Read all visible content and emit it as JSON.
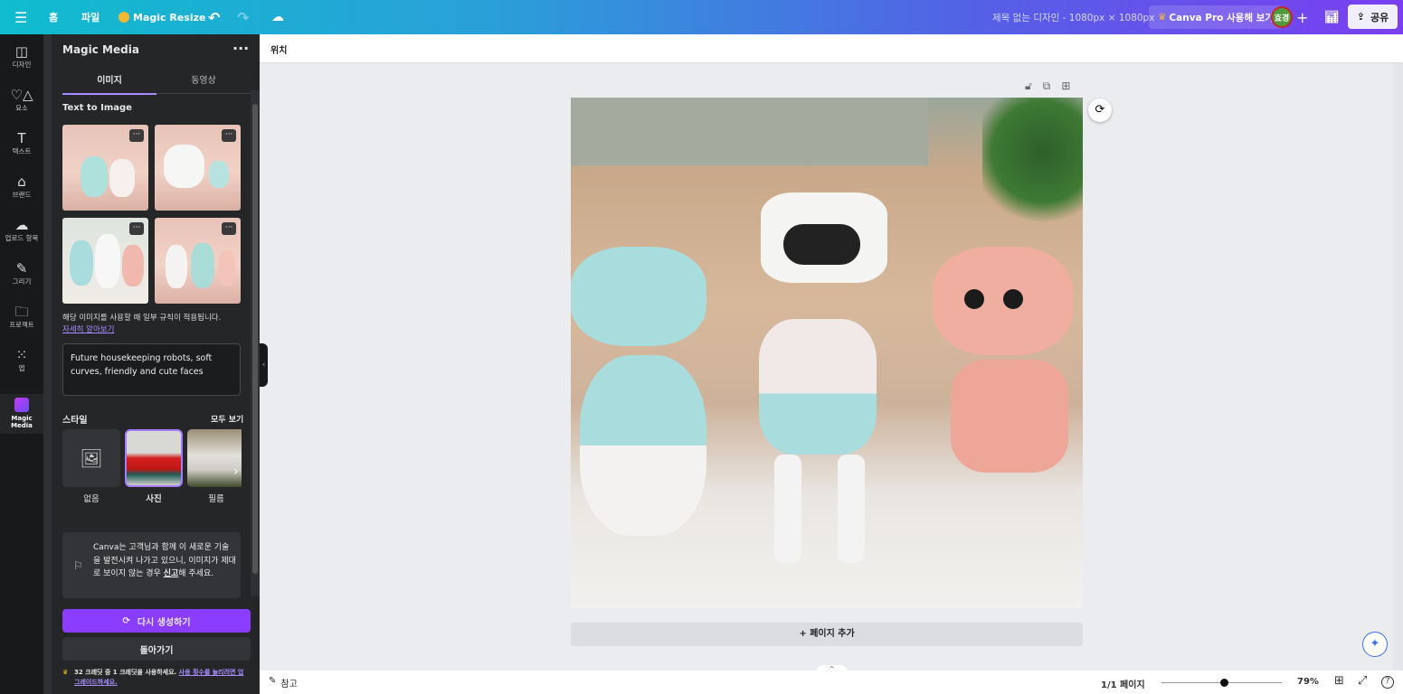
{
  "topbar": {
    "menu_icon": "hamburger-icon",
    "home": "홈",
    "file": "파일",
    "magic_resize": "Magic Resize",
    "title": "제목 없는 디자인 - 1080px × 1080px",
    "pro": "Canva Pro 사용해 보기",
    "avatar": "효경",
    "share": "공유"
  },
  "rail": [
    {
      "label": "디자인",
      "icon": "layout-icon"
    },
    {
      "label": "요소",
      "icon": "shapes-icon"
    },
    {
      "label": "텍스트",
      "icon": "text-icon"
    },
    {
      "label": "브랜드",
      "icon": "brand-icon"
    },
    {
      "label": "업로드 항목",
      "icon": "upload-cloud-icon"
    },
    {
      "label": "그리기",
      "icon": "draw-icon"
    },
    {
      "label": "프로젝트",
      "icon": "folder-icon"
    },
    {
      "label": "앱",
      "icon": "apps-grid-icon"
    },
    {
      "label": "Magic Media",
      "icon": "magic-media-icon"
    }
  ],
  "panel": {
    "title": "Magic Media",
    "tabs": [
      "이미지",
      "동영상"
    ],
    "section": "Text to Image",
    "notice": "해당 이미지를 사용할 때 일부 규칙이 적용됩니다.",
    "learn_more": "자세히 알아보기",
    "prompt": "Future housekeeping robots, soft curves, friendly and cute faces",
    "style_label": "스타일",
    "see_all": "모두 보기",
    "styles": [
      "없음",
      "사진",
      "필름"
    ],
    "selected_style": "사진",
    "feedback": "Canva는 고객님과 함께 이 새로운 기술을 발전시켜 나가고 있으니, 이미지가 제대로 보이지 않는 경우",
    "feedback_link": "신고",
    "feedback_end": "해 주세요.",
    "regenerate": "다시 생성하기",
    "back": "돌아가기",
    "credits": "32 크레딧 중 1 크레딧을 사용하세요.",
    "upgrade": "사용 횟수를 늘리려면 업그레이드하세요."
  },
  "canvas": {
    "position": "위치",
    "add_page": "+ 페이지 추가"
  },
  "bottom": {
    "notes": "참고",
    "page": "1/1 페이지",
    "zoom_percent": 79,
    "zoom_label": "79%"
  },
  "colors": {
    "accent": "#8b3dff",
    "panel": "#252627"
  }
}
